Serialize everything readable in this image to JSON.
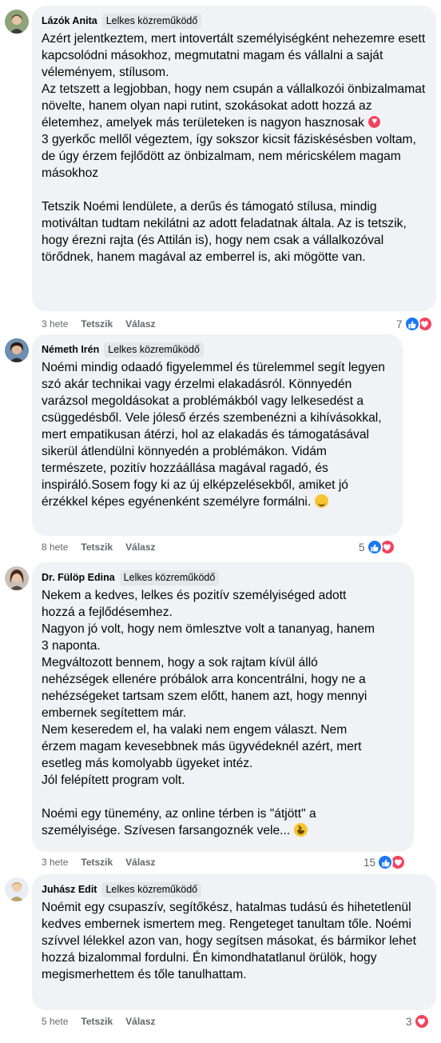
{
  "comments": [
    {
      "author": "Lázók Anita",
      "badge": "Lelkes közreműködő",
      "lines": [
        "Azért jelentkeztem, mert intovertált személyiségként nehezemre esett kapcsolódni másokhoz, megmutatni magam és vállalni a saját véleményem, stílusom.",
        "Az tetszett a legjobban, hogy nem csupán a vállalkozói önbizalmamat növelte, hanem olyan napi rutint, szokásokat adott hozzá az életemhez, amelyek más területeken is nagyon hasznosak",
        "3 gyerkőc mellől végeztem, így sokszor kicsit fáziskésésben voltam, de úgy érzem fejlődött az önbizalmam, nem méricskélem magam másokhoz",
        "",
        "Tetszik Noémi lendülete, a derűs és támogató stílusa, mindig motiváltan tudtam nekilátni az adott feladatnak általa. Az is tetszik, hogy érezni rajta (és Attilán is), hogy nem csak a vállalkozóval törődnek, hanem magával az emberrel is, aki mögötte van."
      ],
      "time": "3 hete",
      "like_label": "Tetszik",
      "reply_label": "Válasz",
      "reaction_count": "7",
      "reactions": [
        "like-icon",
        "love-icon"
      ]
    },
    {
      "author": "Németh Irén",
      "badge": "Lelkes közreműködő",
      "lines": [
        "Noémi mindig odaadó figyelemmel és türelemmel segít legyen szó akár technikai vagy érzelmi elakadásról. Könnyedén varázsol megoldásokat a problémákból vagy lelkesedést a csüggedésből. Vele jóleső érzés szembenézni a kihívásokkal, mert empatikusan átérzi, hol az elakadás és támogatásával sikerül átlendülni könnyedén a problémákon. Vidám természete, pozitív hozzáállása magával ragadó, és inspiráló.Sosem fogy ki az új elképzelésekből, amiket jó érzékkel képes egyénenként személyre formálni."
      ],
      "time": "8 hete",
      "like_label": "Tetszik",
      "reply_label": "Válasz",
      "reaction_count": "5",
      "reactions": [
        "like-icon",
        "love-icon"
      ]
    },
    {
      "author": "Dr. Fülöp Edina",
      "badge": "Lelkes közreműködő",
      "lines": [
        "Nekem a kedves, lelkes és pozitív személyiséged adott hozzá a fejlődésemhez.",
        "Nagyon jó volt, hogy nem ömlesztve volt a tananyag, hanem 3 naponta.",
        "Megváltozott bennem, hogy a sok rajtam kívül álló nehézségek ellenére próbálok arra koncentrálni, hogy ne a nehézségeket tartsam szem előtt, hanem azt, hogy mennyi embernek segítettem már.",
        "Nem keseredem el, ha valaki nem engem választ. Nem érzem magam kevesebbnek más ügyvédeknél azért, mert esetleg más komolyabb ügyeket intéz.",
        "Jól felépített program volt.",
        "",
        "Noémi egy tünemény, az online térben is \"átjött\" a személyisége. Szívesen farsangoznék vele..."
      ],
      "time": "3 hete",
      "like_label": "Tetszik",
      "reply_label": "Válasz",
      "reaction_count": "15",
      "reactions": [
        "like-icon",
        "love-icon"
      ]
    },
    {
      "author": "Juhász Edit",
      "badge": "Lelkes közreműködő",
      "lines": [
        "Noémit egy csupaszív, segítőkész, hatalmas tudású és hihetetlenül kedves embernek ismertem meg. Rengeteget tanultam tőle. Noémi szívvel lélekkel azon van, hogy segítsen másokat, és bármikor lehet hozzá bizalommal fordulni. Én kimondhatatlanul örülök, hogy megismerhettem és tőle tanulhattam."
      ],
      "time": "5 hete",
      "like_label": "Tetszik",
      "reply_label": "Válasz",
      "reaction_count": "3",
      "reactions": [
        "love-icon"
      ]
    }
  ],
  "colors": {
    "bubble_bg": "#f0f2f5",
    "badge_bg": "#e4e6eb",
    "meta_text": "#65676b",
    "like_blue": "#1877f2",
    "love_red": "#f3425f"
  }
}
